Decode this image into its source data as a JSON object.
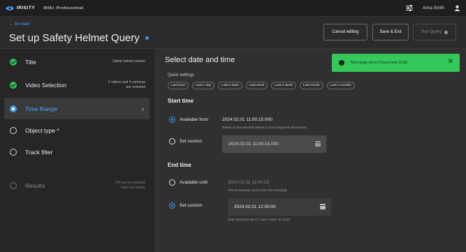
{
  "topbar": {
    "logo": "IRISITY",
    "product": "IRIS+ Professional",
    "user": "Anna Smith"
  },
  "header": {
    "back": "← Go back",
    "title": "Set up Safety Helmet Query",
    "cancel": "Cancel editing",
    "save": "Save & Exit",
    "run": "Run Query"
  },
  "sidebar": {
    "steps": [
      {
        "label": "Title",
        "note": "Safety helmet search"
      },
      {
        "label": "Video Selection",
        "note_line1": "2 videos and 4 cameras",
        "note_line2": "are selected"
      },
      {
        "label": "Time Range",
        "chevron": "›"
      },
      {
        "label": "Object type *"
      },
      {
        "label": "Track filter"
      },
      {
        "label": "Results",
        "note_line1": "Fill out the required",
        "note_line2": "fields for results"
      }
    ]
  },
  "main": {
    "title": "Select date and time",
    "quick_label": "Quick settings",
    "chips": [
      "Last hour",
      "Last 1 day",
      "Last 2 days",
      "Last week",
      "Last 2 week",
      "Last month",
      "Last 2 months"
    ],
    "start": {
      "title": "Start time",
      "available_label": "Available from",
      "available_value": "2024.02.01   11:00:15.000",
      "available_hint": "Based on the selected videos or pre-configured information.",
      "custom_label": "Set custom",
      "custom_value": "2024.02.01   11:00:15.000"
    },
    "end": {
      "title": "End time",
      "available_label": "Available until",
      "available_value": "2024.02.02   11:00:15",
      "available_hint": "This timestamp comes from the metadata",
      "custom_label": "Set custom",
      "custom_value": "2024.02.01   12:00:00",
      "custom_hint": "Date had been set to \"Last 1 Hour\" at 12:00"
    }
  },
  "toast": {
    "text": "Time range set to 2 hours from 11:00",
    "close": "✕"
  }
}
